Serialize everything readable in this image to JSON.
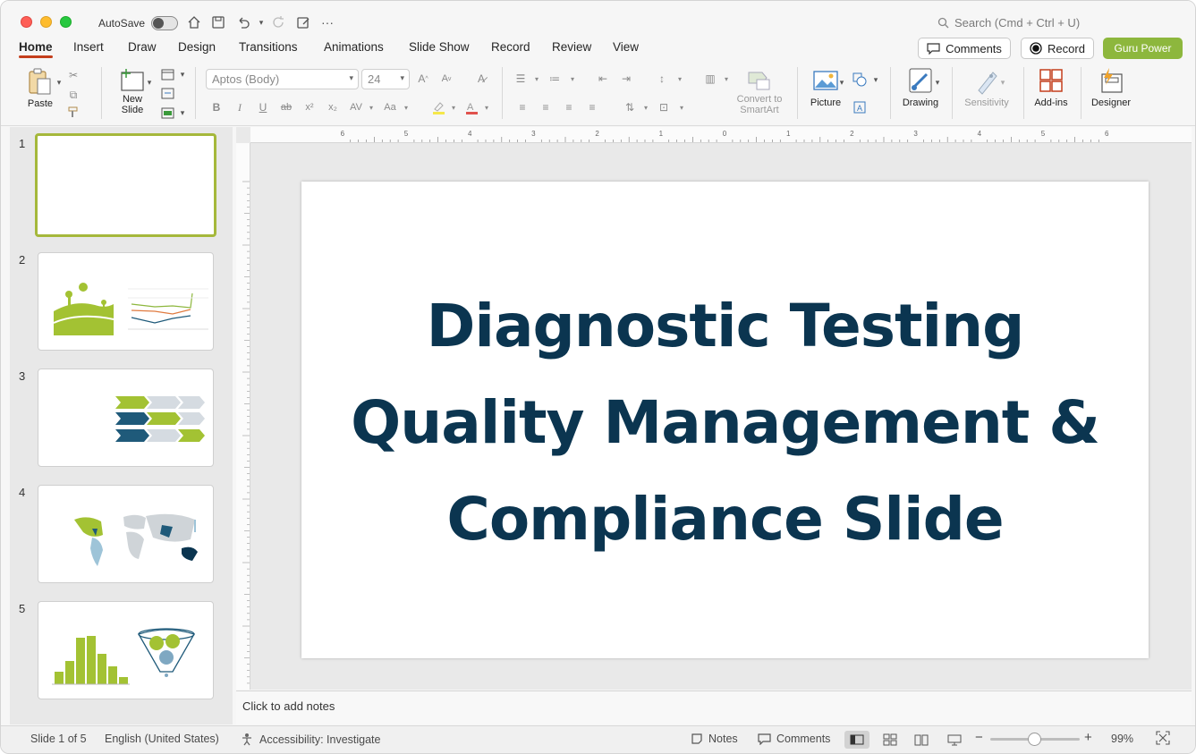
{
  "titlebar": {
    "autosave_label": "AutoSave",
    "search_placeholder": "Search (Cmd + Ctrl + U)"
  },
  "tabs": [
    "Home",
    "Insert",
    "Draw",
    "Design",
    "Transitions",
    "Animations",
    "Slide Show",
    "Record",
    "Review",
    "View"
  ],
  "header_buttons": {
    "comments": "Comments",
    "record": "Record",
    "guru": "Guru Power"
  },
  "ribbon": {
    "paste": "Paste",
    "new_slide_line1": "New",
    "new_slide_line2": "Slide",
    "font_name": "Aptos (Body)",
    "font_size": "24",
    "convert_line1": "Convert to",
    "convert_line2": "SmartArt",
    "picture": "Picture",
    "drawing": "Drawing",
    "sensitivity": "Sensitivity",
    "addins": "Add-ins",
    "designer": "Designer"
  },
  "thumbnails": [
    "1",
    "2",
    "3",
    "4",
    "5"
  ],
  "slide": {
    "title_line1": "Diagnostic Testing",
    "title_line2": "Quality Management &",
    "title_line3": "Compliance Slide"
  },
  "notes_placeholder": "Click to add notes",
  "status": {
    "slide_info": "Slide 1 of 5",
    "language": "English (United States)",
    "accessibility": "Accessibility: Investigate",
    "notes": "Notes",
    "comments": "Comments",
    "zoom": "99%"
  },
  "ruler_labels": [
    "6",
    "5",
    "4",
    "3",
    "2",
    "1",
    "0",
    "1",
    "2",
    "3",
    "4",
    "5",
    "6"
  ],
  "colors": {
    "accent_tab": "#c43e1c",
    "guru_green": "#8db73d",
    "title_navy": "#0b3550",
    "thumb_green": "#a3c233",
    "thumb_navy": "#1f5a7a"
  }
}
